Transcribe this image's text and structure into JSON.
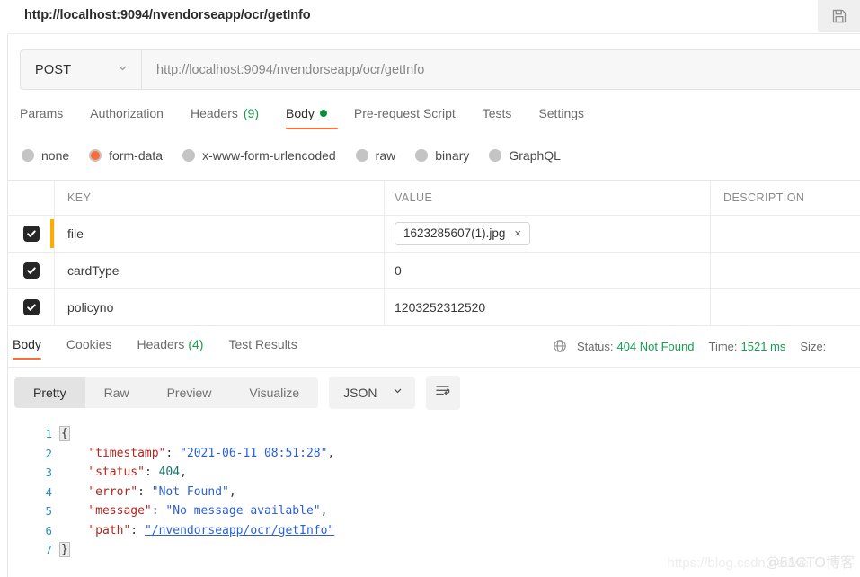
{
  "titlebar": {
    "title": "http://localhost:9094/nvendorseapp/ocr/getInfo",
    "save_icon": "floppy-save-icon"
  },
  "request": {
    "method": "POST",
    "method_chevron": "chevron-down-icon",
    "url": "http://localhost:9094/nvendorseapp/ocr/getInfo",
    "tabs": [
      {
        "label": "Params",
        "active": false
      },
      {
        "label": "Authorization",
        "active": false
      },
      {
        "label": "Headers",
        "count": "(9)",
        "active": false
      },
      {
        "label": "Body",
        "dot": true,
        "active": true
      },
      {
        "label": "Pre-request Script",
        "active": false
      },
      {
        "label": "Tests",
        "active": false
      },
      {
        "label": "Settings",
        "active": false
      }
    ],
    "body_types": [
      {
        "label": "none",
        "selected": false
      },
      {
        "label": "form-data",
        "selected": true
      },
      {
        "label": "x-www-form-urlencoded",
        "selected": false
      },
      {
        "label": "raw",
        "selected": false
      },
      {
        "label": "binary",
        "selected": false
      },
      {
        "label": "GraphQL",
        "selected": false
      }
    ],
    "table": {
      "columns": [
        "KEY",
        "VALUE",
        "DESCRIPTION"
      ],
      "rows": [
        {
          "checked": true,
          "focused": true,
          "key": "file",
          "value": "1623285607(1).jpg",
          "value_is_file": true,
          "remove_label": "×",
          "description": ""
        },
        {
          "checked": true,
          "focused": false,
          "key": "cardType",
          "value": "0",
          "value_is_file": false,
          "description": ""
        },
        {
          "checked": true,
          "focused": false,
          "key": "policyno",
          "value": "1203252312520",
          "value_is_file": false,
          "description": ""
        }
      ]
    }
  },
  "response": {
    "tabs": [
      {
        "label": "Body",
        "active": true
      },
      {
        "label": "Cookies",
        "active": false
      },
      {
        "label": "Headers",
        "count": "(4)",
        "active": false
      },
      {
        "label": "Test Results",
        "active": false
      }
    ],
    "meta": {
      "globe_icon": "globe-icon",
      "status_label": "Status:",
      "status_value": "404 Not Found",
      "time_label": "Time:",
      "time_value": "1521 ms",
      "size_label": "Size:",
      "status_color": "#12a150"
    },
    "toolbar": {
      "views": [
        {
          "label": "Pretty",
          "active": true
        },
        {
          "label": "Raw",
          "active": false
        },
        {
          "label": "Preview",
          "active": false
        },
        {
          "label": "Visualize",
          "active": false
        }
      ],
      "format": "JSON",
      "format_chevron": "chevron-down-icon",
      "wrap_icon": "wrap-lines-icon"
    },
    "code": {
      "line_numbers": [
        "1",
        "2",
        "3",
        "4",
        "5",
        "6",
        "7"
      ],
      "lines": [
        {
          "indent": 0,
          "type": "open-brace",
          "text": "{"
        },
        {
          "indent": 1,
          "type": "pair",
          "key": "\"timestamp\"",
          "sep": ": ",
          "value": "\"2021-06-11 08:51:28\"",
          "value_kind": "string",
          "comma": ","
        },
        {
          "indent": 1,
          "type": "pair",
          "key": "\"status\"",
          "sep": ": ",
          "value": "404",
          "value_kind": "number",
          "comma": ","
        },
        {
          "indent": 1,
          "type": "pair",
          "key": "\"error\"",
          "sep": ": ",
          "value": "\"Not Found\"",
          "value_kind": "string",
          "comma": ","
        },
        {
          "indent": 1,
          "type": "pair",
          "key": "\"message\"",
          "sep": ": ",
          "value": "\"No message available\"",
          "value_kind": "string",
          "comma": ","
        },
        {
          "indent": 1,
          "type": "pair",
          "key": "\"path\"",
          "sep": ": ",
          "value": "\"/nvendorseapp/ocr/getInfo\"",
          "value_kind": "link",
          "comma": ""
        },
        {
          "indent": 0,
          "type": "close-brace",
          "text": "}"
        }
      ]
    }
  },
  "watermark": {
    "url_text": "https://blog.csdn.net/wei",
    "brand_text": "@51CTO博客"
  }
}
